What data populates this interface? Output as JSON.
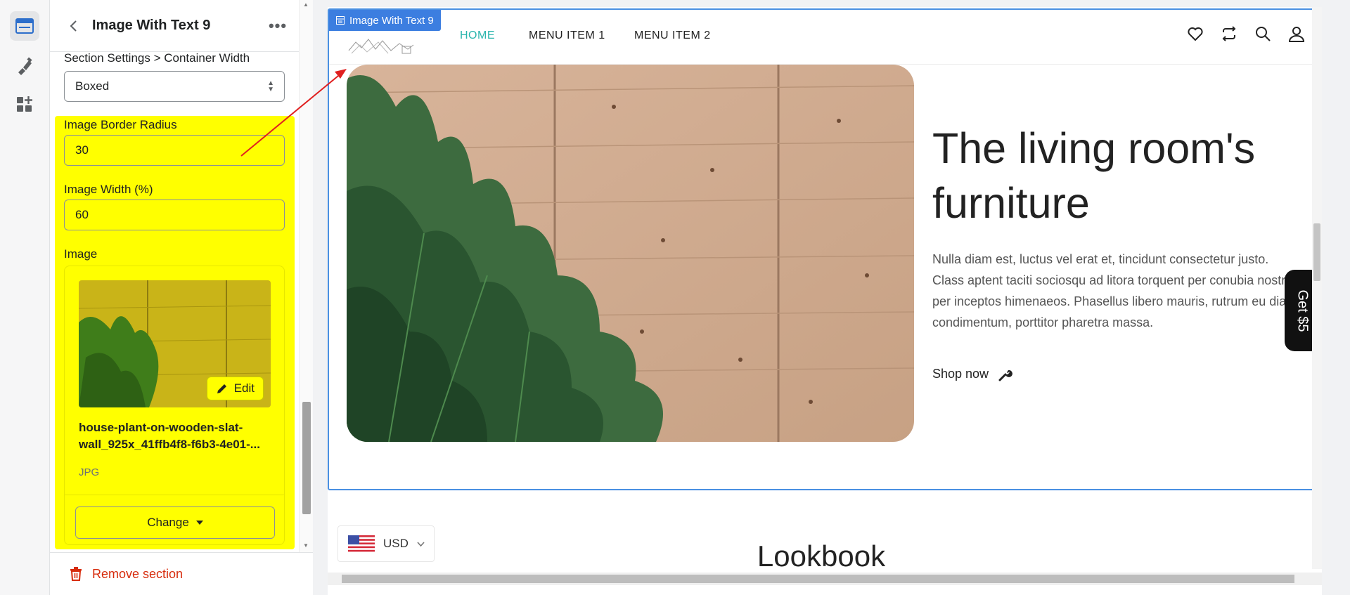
{
  "panel": {
    "title": "Image With Text 9",
    "more_label": "•••",
    "breadcrumb_label": "Section Settings > Container Width",
    "container_width_value": "Boxed",
    "border_radius_label": "Image Border Radius",
    "border_radius_value": "30",
    "image_width_label": "Image Width (%)",
    "image_width_value": "60",
    "image_label": "Image",
    "edit_label": "Edit",
    "file_name": "house-plant-on-wooden-slat-wall_925x_41ffb4f8-f6b3-4e01-...",
    "file_type": "JPG",
    "change_label": "Change",
    "remove_label": "Remove section"
  },
  "preview": {
    "section_tag": "Image With Text 9",
    "menu": [
      "HOME",
      "MENU ITEM 1",
      "MENU ITEM 2"
    ],
    "heading": "The living room's furniture",
    "description": "Nulla diam est, luctus vel erat et, tincidunt consectetur justo. Class aptent taciti sociosqu ad litora torquent per conubia nostra, per inceptos himenaeos. Phasellus libero mauris, rutrum eu diam condimentum, porttitor pharetra massa.",
    "shop_now": "Shop now",
    "get5": "Get $5",
    "currency": "USD",
    "next_section": "Lookbook"
  },
  "colors": {
    "highlight": "#ffff00",
    "accent_teal": "#2bb5ad",
    "frame_blue": "#4a90e2",
    "danger": "#d72c0d",
    "annotation_red": "#e02020"
  },
  "icons": {
    "rail": [
      "sections-icon",
      "theme-brush-icon",
      "apps-add-icon"
    ],
    "nav": [
      "heart-icon",
      "compare-icon",
      "search-icon",
      "user-icon"
    ]
  }
}
